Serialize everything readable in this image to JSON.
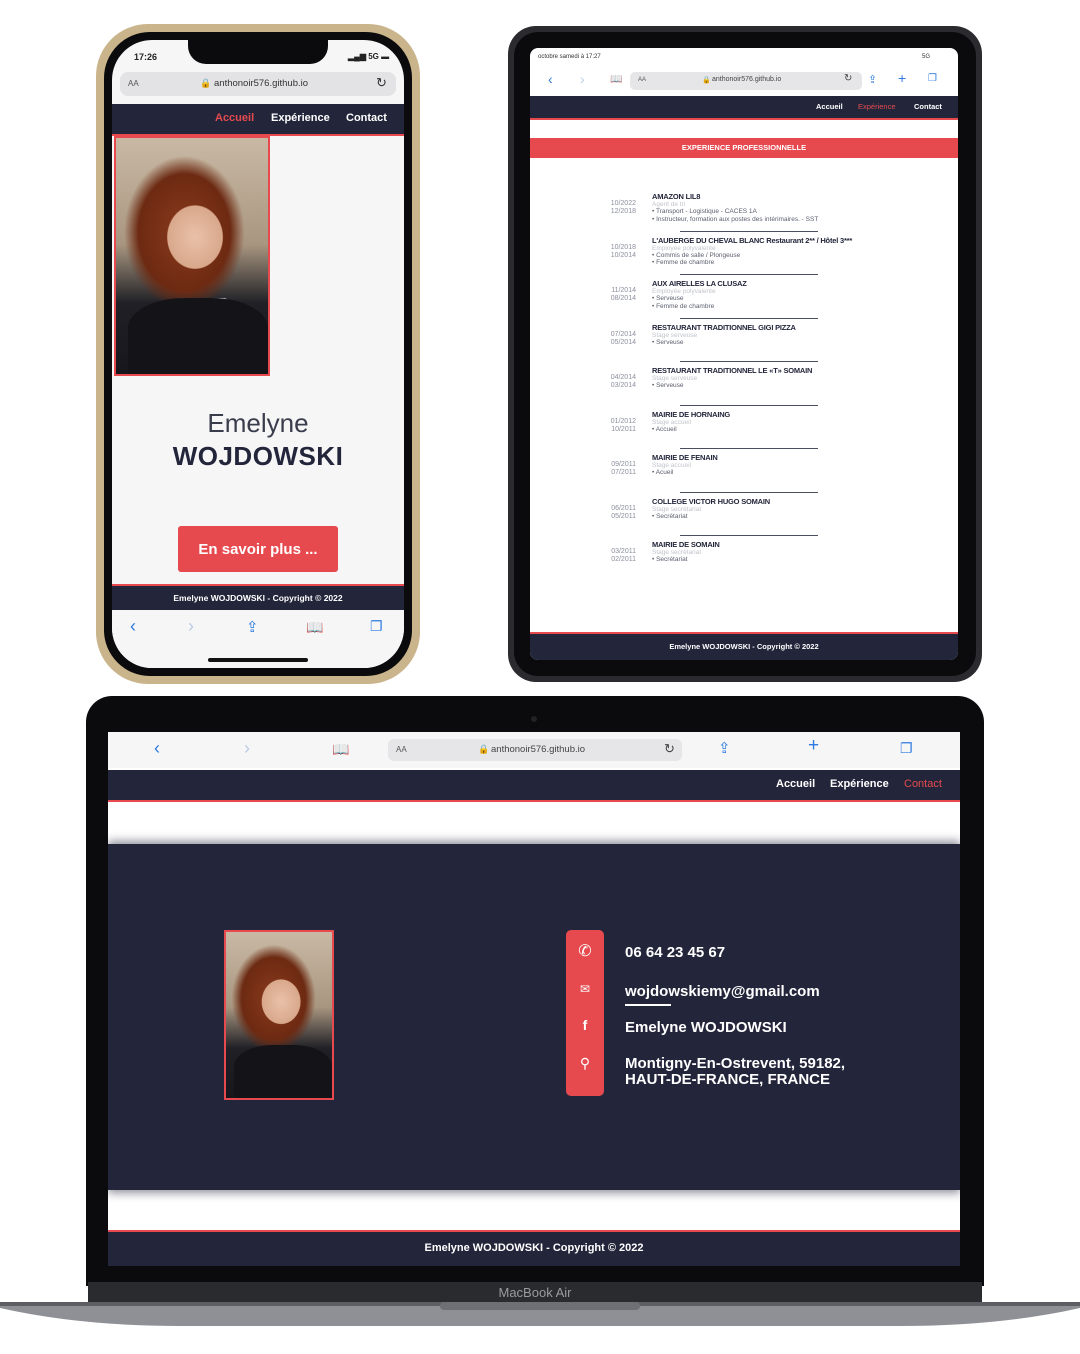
{
  "phone": {
    "status_time": "17:26",
    "status_signal": "5G",
    "url_aa": "AA",
    "url": "anthonoir576.github.io",
    "nav": [
      "Accueil",
      "Expérience",
      "Contact"
    ],
    "first_name": "Emelyne",
    "last_name": "WOJDOWSKI",
    "cta_label": "En savoir plus ...",
    "footer": "Emelyne WOJDOWSKI - Copyright © 2022"
  },
  "tablet": {
    "status_left": "octobre samedi à 17:27",
    "status_right": "5G",
    "url_aa": "AA",
    "url": "anthonoir576.github.io",
    "nav": [
      "Accueil",
      "Expérience",
      "Contact"
    ],
    "section_title": "EXPERIENCE PROFESSIONNELLE",
    "experiences": [
      {
        "date_end": "10/2022",
        "date_start": "12/2018",
        "title": "AMAZON LIL8",
        "role": "Agent de tri",
        "bullets": [
          "• Transport - Logistique - CACES 1A",
          "• Instructeur, formation aux postes des intérimaires. - SST"
        ]
      },
      {
        "date_end": "10/2018",
        "date_start": "10/2014",
        "title": "L'AUBERGE DU CHEVAL BLANC Restaurant 2** / Hôtel 3***",
        "role": "Employée polyvalente",
        "bullets": [
          "• Commis de salle / Plongeuse",
          "• Femme de chambre"
        ]
      },
      {
        "date_end": "11/2014",
        "date_start": "08/2014",
        "title": "AUX AIRELLES LA CLUSAZ",
        "role": "Employée polyvalente",
        "bullets": [
          "• Serveuse",
          "• Femme de chambre"
        ]
      },
      {
        "date_end": "07/2014",
        "date_start": "05/2014",
        "title": "RESTAURANT TRADITIONNEL GIGI PIZZA",
        "role": "Stage serveuse",
        "bullets": [
          "• Serveuse"
        ]
      },
      {
        "date_end": "04/2014",
        "date_start": "03/2014",
        "title": "RESTAURANT TRADITIONNEL LE «T» SOMAIN",
        "role": "Stage serveuse",
        "bullets": [
          "• Serveuse"
        ]
      },
      {
        "date_end": "01/2012",
        "date_start": "10/2011",
        "title": "MAIRIE DE HORNAING",
        "role": "Stage accueil",
        "bullets": [
          "• Accueil"
        ]
      },
      {
        "date_end": "09/2011",
        "date_start": "07/2011",
        "title": "MAIRIE DE FENAIN",
        "role": "Stage accueil",
        "bullets": [
          "• Acueil"
        ]
      },
      {
        "date_end": "06/2011",
        "date_start": "05/2011",
        "title": "COLLEGE VICTOR HUGO SOMAIN",
        "role": "Stage secrétariat",
        "bullets": [
          "• Secrétariat"
        ]
      },
      {
        "date_end": "03/2011",
        "date_start": "02/2011",
        "title": "MAIRIE DE SOMAIN",
        "role": "Stage secrétariat",
        "bullets": [
          "• Secrétariat"
        ]
      }
    ],
    "footer": "Emelyne WOJDOWSKI - Copyright © 2022"
  },
  "laptop": {
    "url_aa": "AA",
    "url": "anthonoir576.github.io",
    "nav": [
      "Accueil",
      "Expérience",
      "Contact"
    ],
    "contact": {
      "phone": "06 64 23 45 67",
      "email": "wojdowskiemy@gmail.com",
      "facebook": "Emelyne WOJDOWSKI",
      "address_line1": "Montigny-En-Ostrevent, 59182,",
      "address_line2": "HAUT-DE-FRANCE, FRANCE"
    },
    "footer": "Emelyne WOJDOWSKI - Copyright © 2022",
    "device_label": "MacBook Air"
  },
  "colors": {
    "navy": "#23263b",
    "accent": "#e64a4f",
    "white": "#ffffff"
  }
}
